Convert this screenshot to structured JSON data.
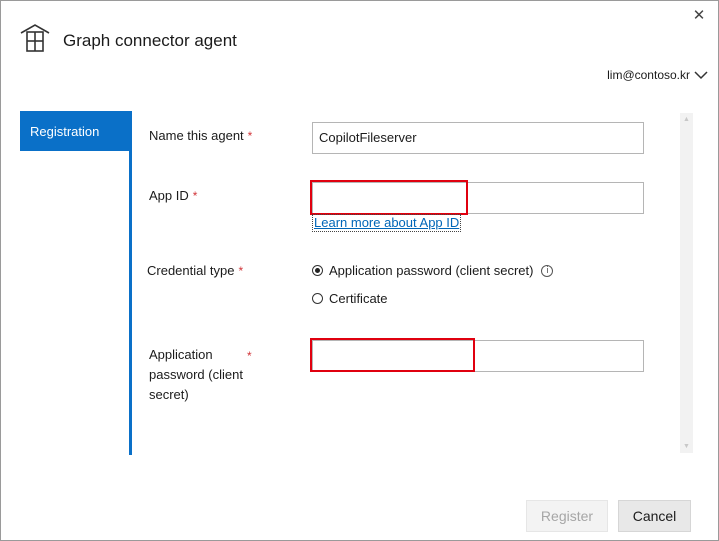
{
  "window": {
    "title": "Graph connector agent",
    "close_glyph": "✕",
    "app_icon": "connector-house-icon"
  },
  "account": {
    "email": "lim@contoso.kr",
    "menu_icon": "chevron-down-icon"
  },
  "nav": {
    "items": [
      {
        "label": "Registration",
        "active": true
      }
    ]
  },
  "form": {
    "agent_name": {
      "label": "Name this agent",
      "value": "CopilotFileserver",
      "required_mark": "*"
    },
    "app_id": {
      "label": "App ID",
      "value": "",
      "required_mark": "*",
      "help_link": "Learn more about App ID"
    },
    "credential_type": {
      "label": "Credential type",
      "required_mark": "*",
      "options": [
        {
          "label": "Application password (client secret)",
          "selected": true,
          "info_icon": "info-icon"
        },
        {
          "label": "Certificate",
          "selected": false
        }
      ]
    },
    "app_password": {
      "label_lines": [
        "Application",
        "password (client",
        "secret)"
      ],
      "value": "",
      "required_mark": "*"
    }
  },
  "actions": {
    "register": {
      "label": "Register",
      "enabled": false
    },
    "cancel": {
      "label": "Cancel",
      "enabled": true
    }
  },
  "colors": {
    "accent": "#0a70c8",
    "required": "#d13438",
    "highlight_box": "#e0000f",
    "link": "#0066b8"
  }
}
